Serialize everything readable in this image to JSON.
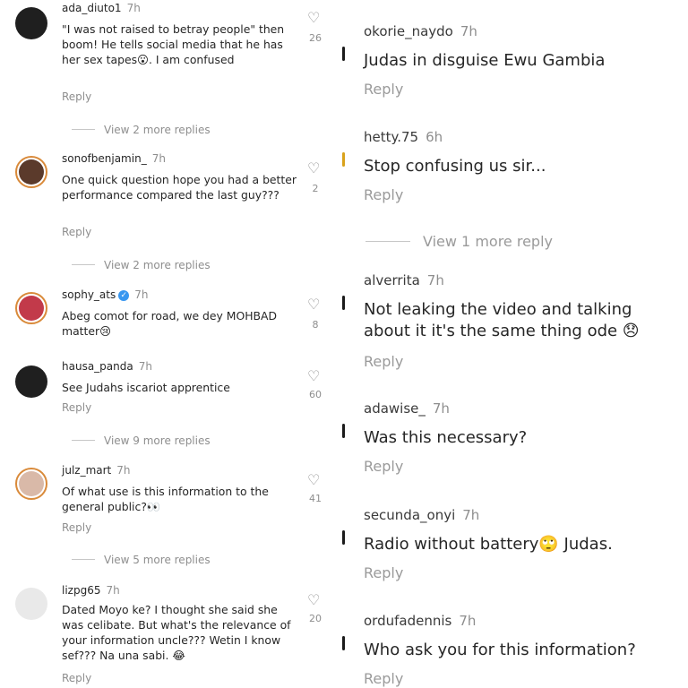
{
  "left": {
    "comments": [
      {
        "username": "ada_diuto1",
        "time": "7h",
        "text": "\"I was not raised to betray people\" then boom! He tells social media that he has her sex tapes😮. I am confused",
        "reply": "Reply",
        "likes": "26"
      },
      {
        "username": "sonofbenjamin_",
        "time": "7h",
        "text": "One quick question hope you had a better performance compared the last guy???",
        "reply": "Reply",
        "likes": "2"
      },
      {
        "username": "sophy_ats",
        "time": "7h",
        "text": "Abeg comot for road, we dey MOHBAD matter😢",
        "reply": "",
        "likes": "8"
      },
      {
        "username": "hausa_panda",
        "time": "7h",
        "text": "See Judahs iscariot apprentice",
        "reply": "Reply",
        "likes": "60"
      },
      {
        "username": "julz_mart",
        "time": "7h",
        "text": "Of what use is this information to the general public?👀",
        "reply": "Reply",
        "likes": "41"
      },
      {
        "username": "lizpg65",
        "time": "7h",
        "text": "Dated Moyo ke? I thought she said she was celibate. But what's the relevance of your information uncle??? Wetin I know sef??? Na una sabi. 😂",
        "reply": "Reply",
        "likes": "20"
      }
    ],
    "view_more": [
      "View 2 more replies",
      "View 2 more replies",
      "View 9 more replies",
      "View 5 more replies"
    ]
  },
  "right": {
    "comments": [
      {
        "username": "okorie_naydo",
        "time": "7h",
        "text": "Judas in disguise Ewu Gambia",
        "reply": "Reply"
      },
      {
        "username": "hetty.75",
        "time": "6h",
        "text": "Stop confusing us sir...",
        "reply": "Reply"
      },
      {
        "username": "alverrita",
        "time": "7h",
        "text": "Not leaking the video and talking about it it's the same thing ode 😞",
        "reply": "Reply"
      },
      {
        "username": "adawise_",
        "time": "7h",
        "text": "Was this necessary?",
        "reply": "Reply"
      },
      {
        "username": "secunda_onyi",
        "time": "7h",
        "text": "Radio without battery🙄 Judas.",
        "reply": "Reply"
      },
      {
        "username": "ordufadennis",
        "time": "7h",
        "text": "Who ask you for this information?",
        "reply": "Reply"
      }
    ],
    "view_more": "View 1 more reply"
  },
  "icons": {
    "like": "heart-outline-icon",
    "verified": "verified-badge-icon"
  },
  "colors": {
    "text": "#262626",
    "muted": "#8e8e8e",
    "verified": "#3897f0",
    "story_ring": "#d98a3a"
  }
}
